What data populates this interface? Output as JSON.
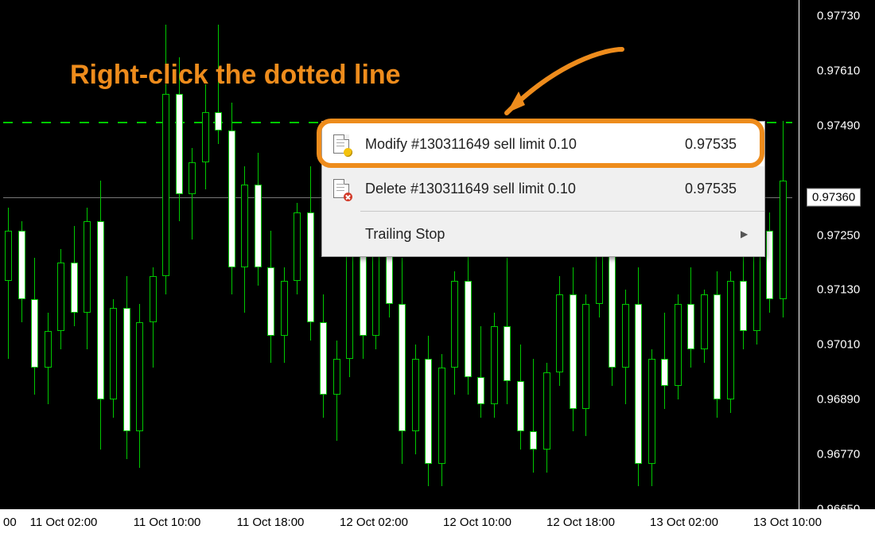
{
  "annotation": "Right-click the dotted line",
  "price_marker": "0.97360",
  "y_ticks": [
    "0.97730",
    "0.97610",
    "0.97490",
    "0.97250",
    "0.97130",
    "0.97010",
    "0.96890",
    "0.96770",
    "0.96650"
  ],
  "x_ticks": [
    "00",
    "11 Oct 02:00",
    "11 Oct 10:00",
    "11 Oct 18:00",
    "12 Oct 02:00",
    "12 Oct 10:00",
    "12 Oct 18:00",
    "13 Oct 02:00",
    "13 Oct 10:00"
  ],
  "context_menu": {
    "modify": {
      "label": "Modify #130311649 sell limit 0.10",
      "price": "0.97535"
    },
    "delete": {
      "label": "Delete #130311649 sell limit 0.10",
      "price": "0.97535"
    },
    "trailing": {
      "label": "Trailing Stop"
    }
  },
  "chart_data": {
    "type": "candlestick",
    "xlabel": "",
    "ylabel": "",
    "ylim": [
      0.9665,
      0.9773
    ],
    "order_level": 0.97535,
    "current_price": 0.9736,
    "categories": [
      "11 Oct 02:00",
      "11 Oct 10:00",
      "11 Oct 18:00",
      "12 Oct 02:00",
      "12 Oct 10:00",
      "12 Oct 18:00",
      "13 Oct 02:00",
      "13 Oct 10:00"
    ],
    "candles": [
      {
        "o": 0.9715,
        "h": 0.9731,
        "l": 0.9698,
        "c": 0.9726
      },
      {
        "o": 0.9726,
        "h": 0.9728,
        "l": 0.9706,
        "c": 0.9711
      },
      {
        "o": 0.9711,
        "h": 0.972,
        "l": 0.969,
        "c": 0.9696
      },
      {
        "o": 0.9696,
        "h": 0.9708,
        "l": 0.9688,
        "c": 0.9704
      },
      {
        "o": 0.9704,
        "h": 0.9722,
        "l": 0.97,
        "c": 0.9719
      },
      {
        "o": 0.9719,
        "h": 0.9727,
        "l": 0.9705,
        "c": 0.9708
      },
      {
        "o": 0.9708,
        "h": 0.9731,
        "l": 0.97,
        "c": 0.9728
      },
      {
        "o": 0.9728,
        "h": 0.9737,
        "l": 0.9678,
        "c": 0.9689
      },
      {
        "o": 0.9689,
        "h": 0.9711,
        "l": 0.9685,
        "c": 0.9709
      },
      {
        "o": 0.9709,
        "h": 0.9716,
        "l": 0.9676,
        "c": 0.9682
      },
      {
        "o": 0.9682,
        "h": 0.971,
        "l": 0.9674,
        "c": 0.9706
      },
      {
        "o": 0.9706,
        "h": 0.9718,
        "l": 0.9696,
        "c": 0.9716
      },
      {
        "o": 0.9716,
        "h": 0.9771,
        "l": 0.9712,
        "c": 0.9756
      },
      {
        "o": 0.9756,
        "h": 0.9764,
        "l": 0.9728,
        "c": 0.9734
      },
      {
        "o": 0.9734,
        "h": 0.9744,
        "l": 0.9724,
        "c": 0.9741
      },
      {
        "o": 0.9741,
        "h": 0.9759,
        "l": 0.9735,
        "c": 0.9752
      },
      {
        "o": 0.9752,
        "h": 0.9771,
        "l": 0.9745,
        "c": 0.9748
      },
      {
        "o": 0.9748,
        "h": 0.9754,
        "l": 0.9712,
        "c": 0.9718
      },
      {
        "o": 0.9718,
        "h": 0.974,
        "l": 0.9708,
        "c": 0.9736
      },
      {
        "o": 0.9736,
        "h": 0.9743,
        "l": 0.9714,
        "c": 0.9718
      },
      {
        "o": 0.9718,
        "h": 0.9726,
        "l": 0.9697,
        "c": 0.9703
      },
      {
        "o": 0.9703,
        "h": 0.9718,
        "l": 0.9697,
        "c": 0.9715
      },
      {
        "o": 0.9715,
        "h": 0.9732,
        "l": 0.9712,
        "c": 0.973
      },
      {
        "o": 0.973,
        "h": 0.974,
        "l": 0.9702,
        "c": 0.9706
      },
      {
        "o": 0.9706,
        "h": 0.9712,
        "l": 0.9685,
        "c": 0.969
      },
      {
        "o": 0.969,
        "h": 0.9702,
        "l": 0.968,
        "c": 0.9698
      },
      {
        "o": 0.9698,
        "h": 0.9732,
        "l": 0.9694,
        "c": 0.973
      },
      {
        "o": 0.973,
        "h": 0.9734,
        "l": 0.9698,
        "c": 0.9703
      },
      {
        "o": 0.9703,
        "h": 0.9733,
        "l": 0.97,
        "c": 0.973
      },
      {
        "o": 0.973,
        "h": 0.9736,
        "l": 0.9707,
        "c": 0.971
      },
      {
        "o": 0.971,
        "h": 0.972,
        "l": 0.9675,
        "c": 0.9682
      },
      {
        "o": 0.9682,
        "h": 0.9701,
        "l": 0.9677,
        "c": 0.9698
      },
      {
        "o": 0.9698,
        "h": 0.9703,
        "l": 0.967,
        "c": 0.9675
      },
      {
        "o": 0.9675,
        "h": 0.9699,
        "l": 0.967,
        "c": 0.9696
      },
      {
        "o": 0.9696,
        "h": 0.9717,
        "l": 0.969,
        "c": 0.9715
      },
      {
        "o": 0.9715,
        "h": 0.9722,
        "l": 0.969,
        "c": 0.9694
      },
      {
        "o": 0.9694,
        "h": 0.9705,
        "l": 0.9685,
        "c": 0.9688
      },
      {
        "o": 0.9688,
        "h": 0.9708,
        "l": 0.9685,
        "c": 0.9705
      },
      {
        "o": 0.9705,
        "h": 0.972,
        "l": 0.9688,
        "c": 0.9693
      },
      {
        "o": 0.9693,
        "h": 0.9701,
        "l": 0.9678,
        "c": 0.9682
      },
      {
        "o": 0.9682,
        "h": 0.9698,
        "l": 0.9673,
        "c": 0.9678
      },
      {
        "o": 0.9678,
        "h": 0.9697,
        "l": 0.9673,
        "c": 0.9695
      },
      {
        "o": 0.9695,
        "h": 0.9716,
        "l": 0.9692,
        "c": 0.9712
      },
      {
        "o": 0.9712,
        "h": 0.9718,
        "l": 0.9682,
        "c": 0.9687
      },
      {
        "o": 0.9687,
        "h": 0.9712,
        "l": 0.9681,
        "c": 0.971
      },
      {
        "o": 0.971,
        "h": 0.9728,
        "l": 0.9707,
        "c": 0.9726
      },
      {
        "o": 0.9726,
        "h": 0.973,
        "l": 0.9692,
        "c": 0.9696
      },
      {
        "o": 0.9696,
        "h": 0.9713,
        "l": 0.9688,
        "c": 0.971
      },
      {
        "o": 0.971,
        "h": 0.9718,
        "l": 0.967,
        "c": 0.9675
      },
      {
        "o": 0.9675,
        "h": 0.97,
        "l": 0.967,
        "c": 0.9698
      },
      {
        "o": 0.9698,
        "h": 0.9708,
        "l": 0.9687,
        "c": 0.9692
      },
      {
        "o": 0.9692,
        "h": 0.9712,
        "l": 0.9689,
        "c": 0.971
      },
      {
        "o": 0.971,
        "h": 0.9718,
        "l": 0.9696,
        "c": 0.97
      },
      {
        "o": 0.97,
        "h": 0.9713,
        "l": 0.9697,
        "c": 0.9712
      },
      {
        "o": 0.9712,
        "h": 0.9717,
        "l": 0.9685,
        "c": 0.9689
      },
      {
        "o": 0.9689,
        "h": 0.9717,
        "l": 0.9686,
        "c": 0.9715
      },
      {
        "o": 0.9715,
        "h": 0.9722,
        "l": 0.97,
        "c": 0.9704
      },
      {
        "o": 0.9704,
        "h": 0.9728,
        "l": 0.9701,
        "c": 0.9726
      },
      {
        "o": 0.9726,
        "h": 0.973,
        "l": 0.9708,
        "c": 0.9711
      },
      {
        "o": 0.9711,
        "h": 0.975,
        "l": 0.9707,
        "c": 0.9737
      }
    ]
  }
}
